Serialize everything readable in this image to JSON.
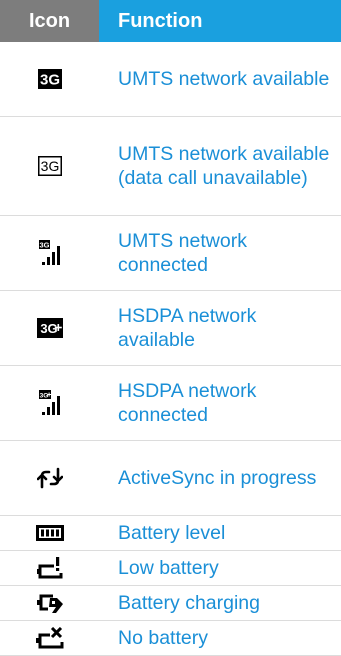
{
  "table": {
    "headers": {
      "icon": "Icon",
      "function": "Function"
    },
    "rows": [
      {
        "icon": "3g-filled-icon",
        "function": "UMTS network available"
      },
      {
        "icon": "3g-outline-icon",
        "function": "UMTS network available (data call unavailable)"
      },
      {
        "icon": "3g-signal-icon",
        "function": "UMTS network connected"
      },
      {
        "icon": "3g-plus-filled-icon",
        "function": "HSDPA network available"
      },
      {
        "icon": "3g-plus-signal-icon",
        "function": "HSDPA network connected"
      },
      {
        "icon": "activesync-icon",
        "function": "ActiveSync in progress"
      },
      {
        "icon": "battery-level-icon",
        "function": "Battery level"
      },
      {
        "icon": "low-battery-icon",
        "function": "Low battery"
      },
      {
        "icon": "battery-charging-icon",
        "function": "Battery charging"
      },
      {
        "icon": "no-battery-icon",
        "function": "No battery"
      }
    ],
    "icon_glyph_text": {
      "three_g": "3G",
      "three_g_plus": "3G+"
    }
  },
  "colors": {
    "header_icon_bg": "#7d7d7d",
    "header_function_bg": "#1aa0df",
    "function_text": "#1a8fd7",
    "divider": "#dcdcdc"
  }
}
